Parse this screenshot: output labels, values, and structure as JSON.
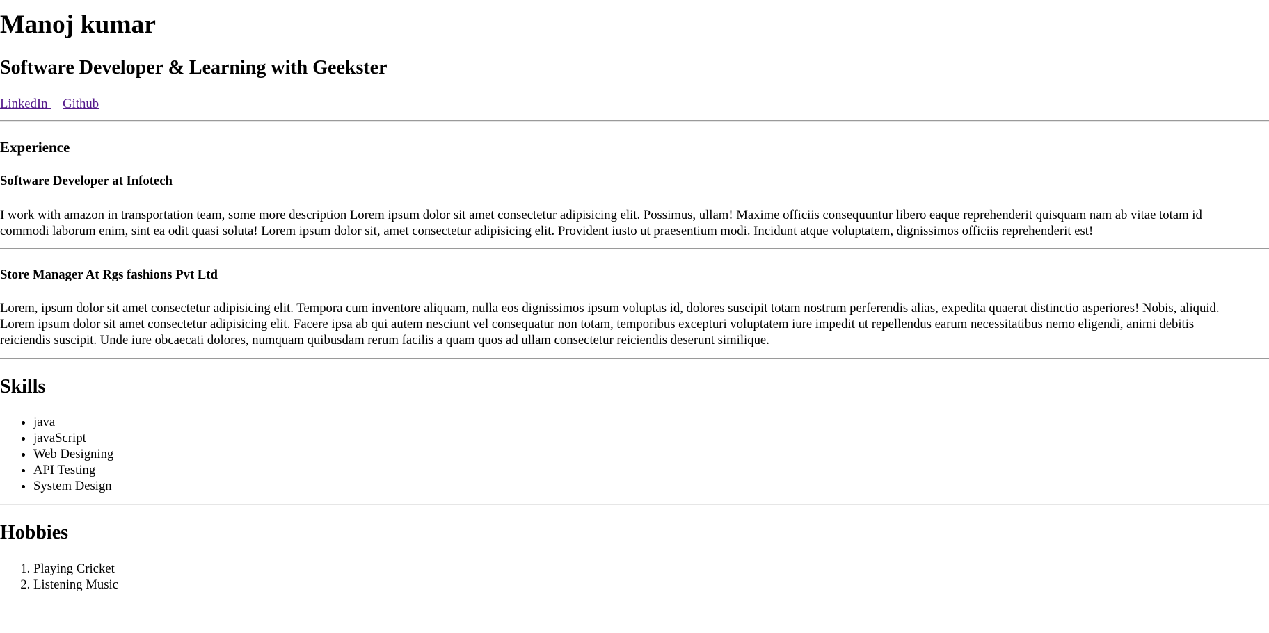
{
  "header": {
    "name": "Manoj kumar",
    "tagline": "Software Developer & Learning with Geekster",
    "links": [
      {
        "label": "LinkedIn"
      },
      {
        "label": "Github"
      }
    ]
  },
  "experience": {
    "heading": "Experience",
    "jobs": [
      {
        "title": "Software Developer at Infotech",
        "description": "I work with amazon in transportation team, some more description Lorem ipsum dolor sit amet consectetur adipisicing elit. Possimus, ullam! Maxime officiis consequuntur libero eaque reprehenderit quisquam nam ab vitae totam id commodi laborum enim, sint ea odit quasi soluta! Lorem ipsum dolor sit, amet consectetur adipisicing elit. Provident iusto ut praesentium modi. Incidunt atque voluptatem, dignissimos officiis reprehenderit est!"
      },
      {
        "title": "Store Manager At Rgs fashions Pvt Ltd",
        "description": "Lorem, ipsum dolor sit amet consectetur adipisicing elit. Tempora cum inventore aliquam, nulla eos dignissimos ipsum voluptas id, dolores suscipit totam nostrum perferendis alias, expedita quaerat distinctio asperiores! Nobis, aliquid. Lorem ipsum dolor sit amet consectetur adipisicing elit. Facere ipsa ab qui autem nesciunt vel consequatur non totam, temporibus excepturi voluptatem iure impedit ut repellendus earum necessitatibus nemo eligendi, animi debitis reiciendis suscipit. Unde iure obcaecati dolores, numquam quibusdam rerum facilis a quam quos ad ullam consectetur reiciendis deserunt similique."
      }
    ]
  },
  "skills": {
    "heading": "Skills",
    "items": [
      "java",
      "javaScript",
      "Web Designing",
      "API Testing",
      "System Design"
    ]
  },
  "hobbies": {
    "heading": "Hobbies",
    "items": [
      "Playing Cricket",
      "Listening Music"
    ]
  },
  "colors": {
    "link_visited": "#551a8b",
    "text": "#000000",
    "rule": "#9a9a9a"
  }
}
